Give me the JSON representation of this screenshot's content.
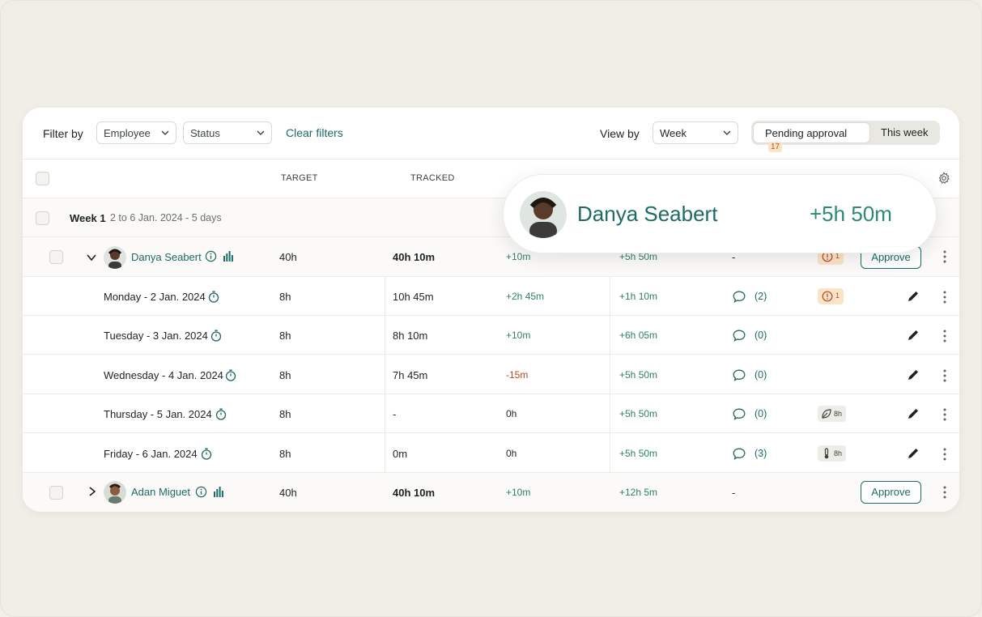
{
  "filters": {
    "filter_by": "Filter by",
    "employee": "Employee",
    "status": "Status",
    "clear": "Clear filters",
    "view_by": "View by",
    "view_value": "Week",
    "pending": "Pending approval",
    "pending_count": "17",
    "this_week": "This week"
  },
  "headers": {
    "target": "TARGET",
    "tracked": "TRACKED"
  },
  "week": {
    "label": "Week 1",
    "range": "2 to 6 Jan. 2024 - 5 days"
  },
  "employees": [
    {
      "name": "Danya Seabert",
      "target": "40h",
      "tracked": "40h 10m",
      "diff": "+10m",
      "balance": "+5h 50m",
      "comments": "-",
      "warn_count": "1",
      "approve": "Approve"
    },
    {
      "name": "Adan Miguet",
      "target": "40h",
      "tracked": "40h 10m",
      "diff": "+10m",
      "balance": "+12h 5m",
      "comments": "-",
      "approve": "Approve"
    }
  ],
  "days": [
    {
      "label": "Monday - 2 Jan. 2024",
      "target": "8h",
      "tracked": "10h 45m",
      "diff": "+2h 45m",
      "balance": "+1h 10m",
      "comments": "(2)",
      "warn_count": "1"
    },
    {
      "label": "Tuesday - 3 Jan. 2024",
      "target": "8h",
      "tracked": "8h 10m",
      "diff": "+10m",
      "balance": "+6h 05m",
      "comments": "(0)"
    },
    {
      "label": "Wednesday - 4 Jan. 2024",
      "target": "8h",
      "tracked": "7h 45m",
      "diff": "-15m",
      "balance": "+5h 50m",
      "comments": "(0)"
    },
    {
      "label": "Thursday - 5 Jan. 2024",
      "target": "8h",
      "tracked": "-",
      "diff": "0h",
      "balance": "+5h 50m",
      "comments": "(0)",
      "chip": "8h"
    },
    {
      "label": "Friday - 6 Jan. 2024",
      "target": "8h",
      "tracked": "0m",
      "diff": "0h",
      "balance": "+5h 50m",
      "comments": "(3)",
      "chip": "8h"
    }
  ],
  "popover": {
    "name": "Danya Seabert",
    "value": "+5h 50m"
  },
  "colors": {
    "teal": "#1d6a66",
    "positive": "#2d7f6b",
    "negative": "#b34a1e",
    "warning_bg": "#fbe3c9"
  }
}
